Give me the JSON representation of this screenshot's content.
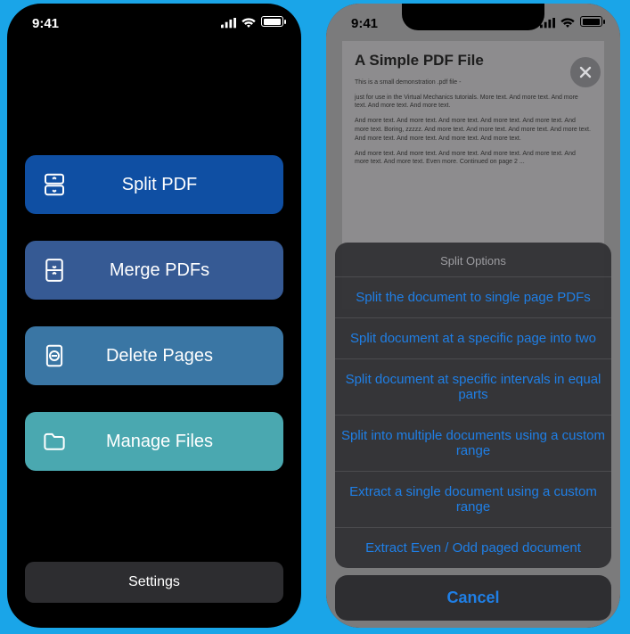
{
  "status": {
    "time": "9:41"
  },
  "left": {
    "buttons": [
      {
        "label": "Split PDF"
      },
      {
        "label": "Merge PDFs"
      },
      {
        "label": "Delete Pages"
      },
      {
        "label": "Manage Files"
      }
    ],
    "settings": "Settings"
  },
  "right": {
    "pdf": {
      "title": "A Simple PDF File",
      "line1": "This is a small demonstration .pdf file -",
      "line2": "just for use in the Virtual Mechanics tutorials. More text. And more text. And more text. And more text. And more text.",
      "line3": "And more text. And more text. And more text. And more text. And more text. And more text. Boring, zzzzz. And more text. And more text. And more text. And more text. And more text. And more text. And more text. And more text.",
      "line4": "And more text. And more text. And more text. And more text. And more text. And more text. And more text. Even more. Continued on page 2 ..."
    },
    "sheet": {
      "title": "Split Options",
      "items": [
        "Split the document to single page PDFs",
        "Split document at a specific page into two",
        "Split document at specific intervals in equal parts",
        "Split into multiple documents using a custom range",
        "Extract a single document using a custom range",
        "Extract Even / Odd paged document"
      ],
      "cancel": "Cancel"
    }
  }
}
